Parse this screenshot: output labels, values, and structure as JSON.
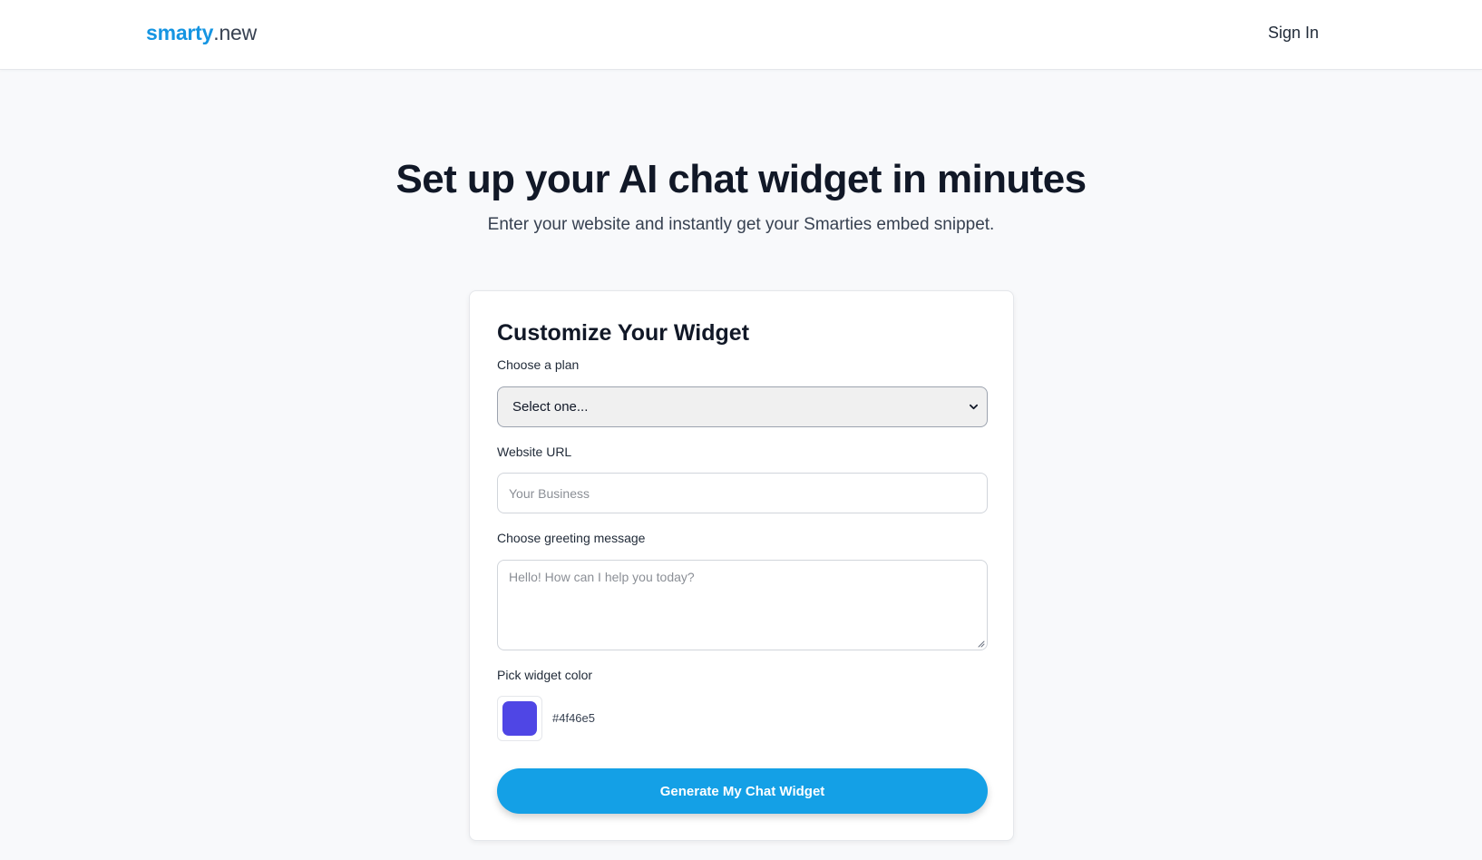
{
  "header": {
    "brand_primary": "smarty",
    "brand_secondary": ".new",
    "signin_label": "Sign In"
  },
  "hero": {
    "title": "Set up your AI chat widget in minutes",
    "subtitle": "Enter your website and instantly get your Smarties embed snippet."
  },
  "form": {
    "title": "Customize Your Widget",
    "plan": {
      "label": "Choose a plan",
      "selected": "Select one..."
    },
    "website": {
      "label": "Website URL",
      "placeholder": "Your Business",
      "value": ""
    },
    "greeting": {
      "label": "Choose greeting message",
      "placeholder": "Hello! How can I help you today?",
      "value": ""
    },
    "color": {
      "label": "Pick widget color",
      "value": "#4f46e5"
    },
    "submit_label": "Generate My Chat Widget"
  },
  "colors": {
    "brand_blue": "#1595e2",
    "button_blue": "#14a0e6",
    "page_bg": "#f8f9fb",
    "widget_color": "#4f46e5"
  },
  "icons": {
    "select_caret": "chevron-down-icon",
    "textarea_resize": "resize-grip-icon"
  }
}
